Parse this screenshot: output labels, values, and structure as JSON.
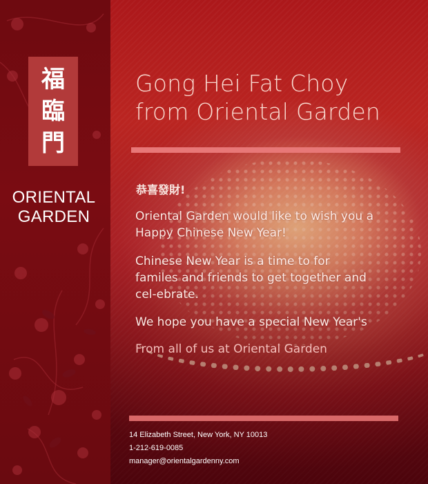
{
  "sidebar": {
    "seal_chars": [
      "福",
      "臨",
      "門"
    ],
    "brand_line1": "ORIENTAL",
    "brand_line2": "GARDEN"
  },
  "content": {
    "title_line1": "Gong Hei Fat Choy",
    "title_line2": "from Oriental Garden",
    "chinese_greeting": "恭喜發財!",
    "paragraph1": "Oriental Garden would like to wish you a Happy Chinese New Year!",
    "paragraph2": "Chinese New Year is a time to for familes and friends to get together and cel-ebrate.",
    "paragraph3": "We hope you have a special New Year's",
    "signoff": "From all of us at Oriental Garden"
  },
  "footer": {
    "address": "14 Elizabeth Street, New York, NY 10013",
    "phone": "1-212-619-0085",
    "email": "manager@orientalgardenny.com"
  },
  "colors": {
    "sidebar": "#6e0a10",
    "seal": "#b23a3a",
    "accent_bar": "#e87878",
    "signoff_text": "#f4c0bc"
  },
  "icons": [
    "floral-pattern"
  ]
}
